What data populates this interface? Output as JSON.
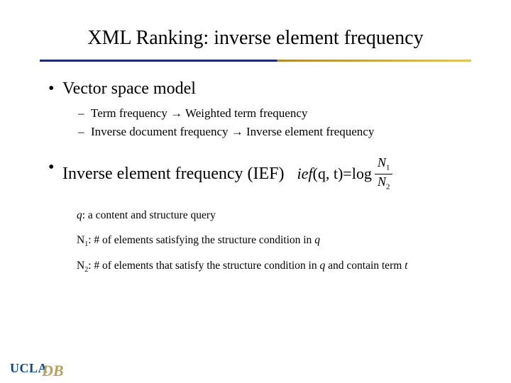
{
  "title": "XML Ranking: inverse element frequency",
  "bullets": {
    "b1": {
      "label": "Vector space model",
      "sub1": "Term frequency → Weighted term frequency",
      "sub2": "Inverse document frequency → Inverse element frequency"
    },
    "b2": {
      "label": "Inverse element frequency (IEF)"
    }
  },
  "formula": {
    "lhs_func": "ief",
    "lhs_args": "(q, t)",
    "eq": " = ",
    "log": "log",
    "num_base": "N",
    "num_sub": "1",
    "den_base": "N",
    "den_sub": "2"
  },
  "defs": {
    "q_var": "q",
    "q_text": ": a content and structure query",
    "n1_var": "N",
    "n1_sub": "1",
    "n1_text_a": ": # of elements satisfying the structure condition in ",
    "n1_text_b": "q",
    "n2_var": "N",
    "n2_sub": "2",
    "n2_text_a": ": # of elements that satisfy the structure condition in ",
    "n2_text_b": "q",
    "n2_text_c": " and contain term ",
    "n2_text_d": "t"
  },
  "logo": {
    "ucla": "UCLA",
    "db": "DB"
  }
}
